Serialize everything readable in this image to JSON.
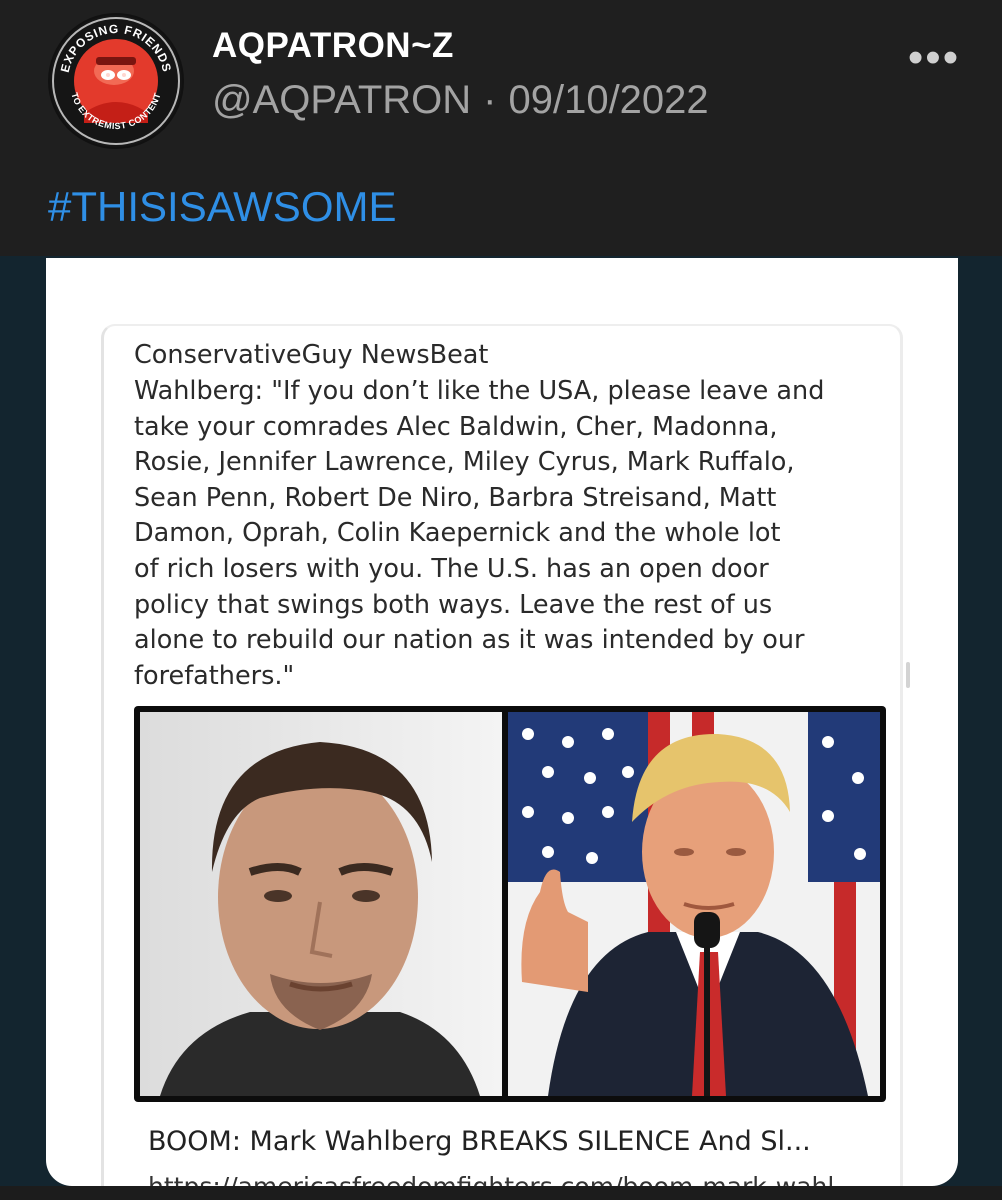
{
  "author": {
    "display_name": "AQPATRON~Z",
    "handle": "@AQPATRON",
    "separator": "·",
    "date": "09/10/2022",
    "avatar_badge_top": "EXPOSING FRIENDS",
    "avatar_badge_bottom": "TO EXTREMIST CONTENT"
  },
  "post": {
    "hashtag": "#THISISAWSOME",
    "more_icon": "more-horizontal-icon"
  },
  "shared_post": {
    "source": "ConservativeGuy NewsBeat",
    "quote_lines": [
      "Wahlberg:  \"If you don’t like the USA, please leave and",
      "take your comrades Alec Baldwin, Cher, Madonna,",
      "Rosie, Jennifer Lawrence, Miley Cyrus, Mark Ruffalo,",
      "Sean Penn, Robert De Niro, Barbra Streisand, Matt",
      "Damon, Oprah, Colin Kaepernick and the whole lot",
      "of rich losers with you. The U.S.  has an open door",
      "policy that swings both ways. Leave the rest of us",
      "alone to rebuild our nation as it was intended by our",
      "forefathers.\""
    ],
    "link_title": "BOOM: Mark Wahlberg BREAKS SILENCE And Sl...",
    "link_url": "https://americasfreedomfighters.com/boom-mark-wahl"
  },
  "colors": {
    "header_bg": "#1f1f1f",
    "hashtag": "#2f8fe6",
    "page_bg": "#13252f",
    "card_bg": "#ffffff"
  }
}
